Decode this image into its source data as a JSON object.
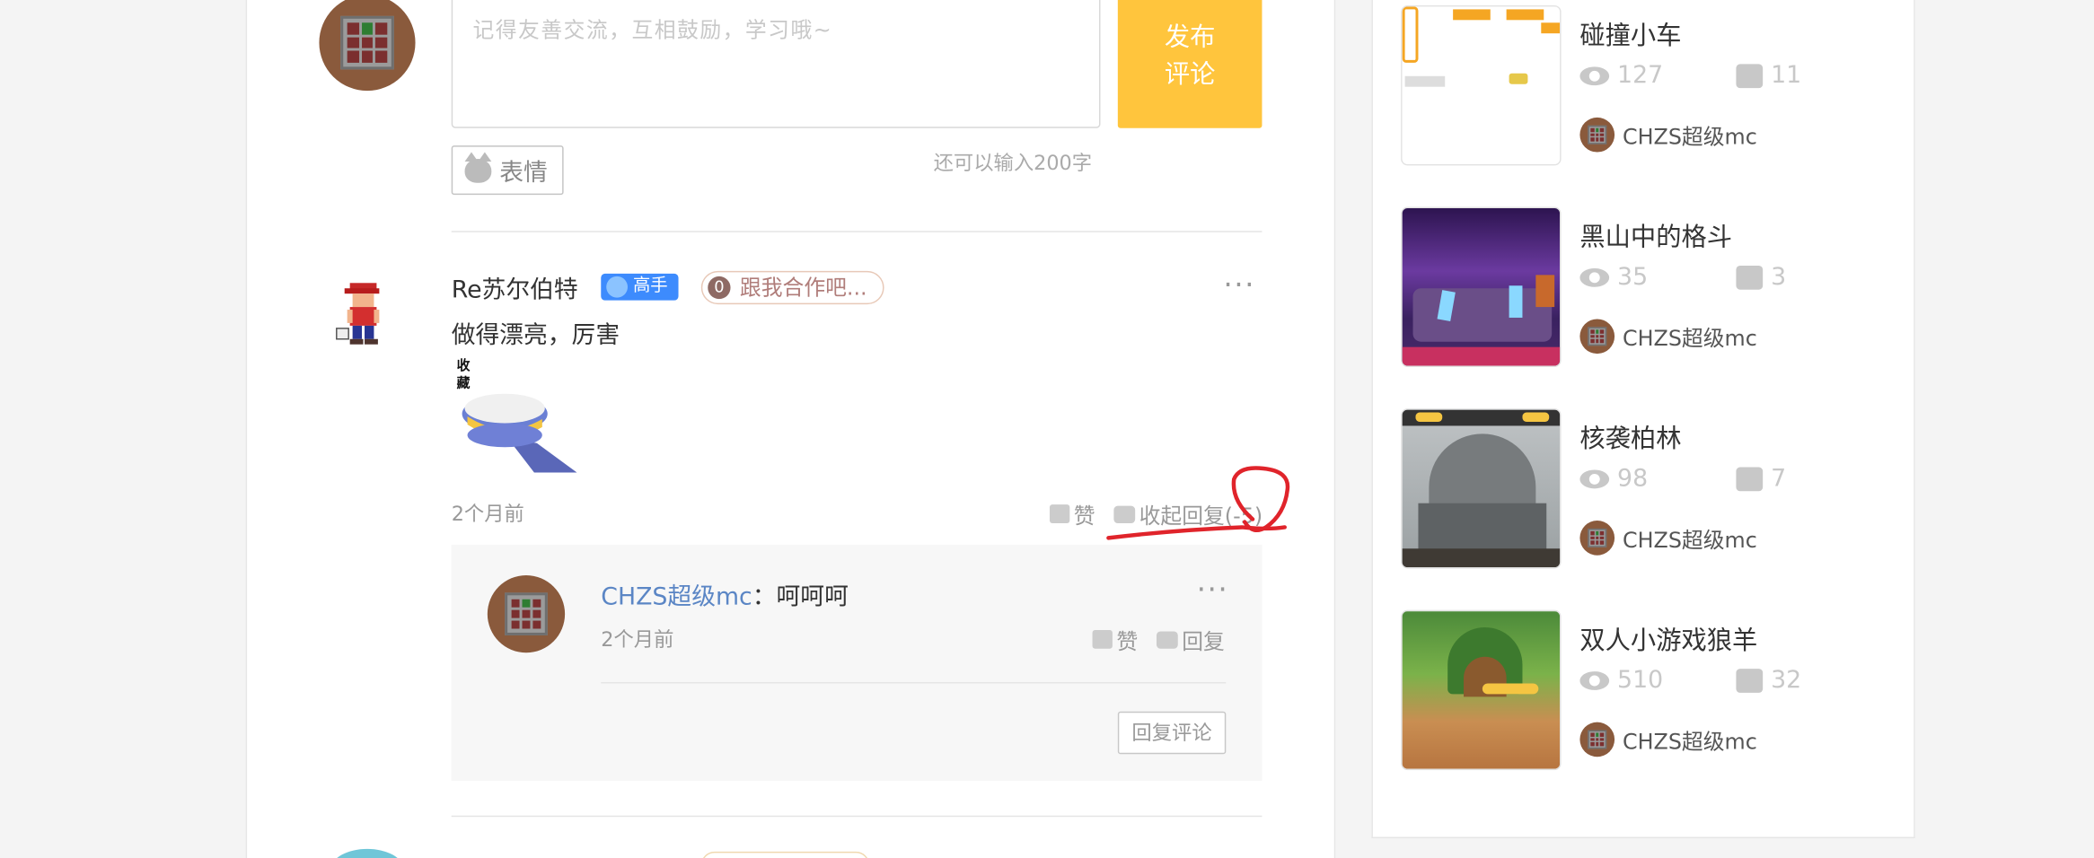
{
  "comment_form": {
    "placeholder": "记得友善交流，互相鼓励，学习哦~",
    "publish_line1": "发布",
    "publish_line2": "评论",
    "emoji_label": "表情",
    "char_count": "还可以输入200字"
  },
  "comment": {
    "user_name": "Re苏尔伯特",
    "level_badge": "高手",
    "coop_count": "0",
    "coop_label": "跟我合作吧...",
    "text": "做得漂亮，厉害",
    "sticker_text": "收藏",
    "time": "2个月前",
    "like_label": "赞",
    "collapse_label": "收起回复(-5)",
    "more": "···"
  },
  "reply": {
    "user_name": "CHZS超级mc",
    "separator": "：",
    "text": "呵呵呵",
    "time": "2个月前",
    "like_label": "赞",
    "reply_label": "回复",
    "reply_button": "回复评论",
    "more": "···"
  },
  "sidebar": {
    "games": [
      {
        "title": "碰撞小车",
        "views": "127",
        "likes": "11",
        "author": "CHZS超级mc",
        "thumb_style": "white"
      },
      {
        "title": "黑山中的格斗",
        "views": "35",
        "likes": "3",
        "author": "CHZS超级mc",
        "thumb_style": "purple"
      },
      {
        "title": "核袭柏林",
        "views": "98",
        "likes": "7",
        "author": "CHZS超级mc",
        "thumb_style": "gray"
      },
      {
        "title": "双人小游戏狼羊",
        "views": "510",
        "likes": "32",
        "author": "CHZS超级mc",
        "thumb_style": "green"
      }
    ]
  },
  "colors": {
    "accent_yellow": "#ffc53d",
    "link_blue": "#5b86c5",
    "annotation_red": "#e0242b"
  }
}
